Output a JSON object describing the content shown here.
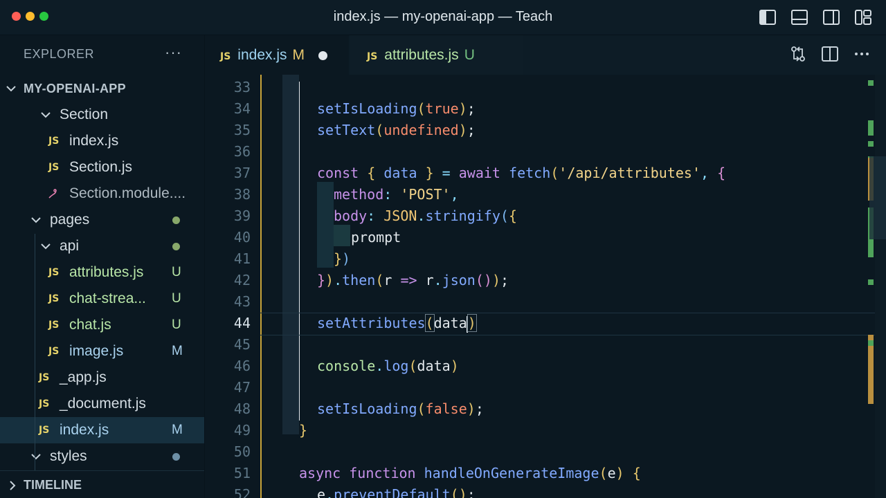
{
  "window": {
    "title": "index.js — my-openai-app — Teach"
  },
  "sidebar": {
    "header": "EXPLORER",
    "more": "···",
    "root": "MY-OPENAI-APP",
    "items": [
      {
        "label": "Section",
        "type": "folder"
      },
      {
        "label": "index.js",
        "type": "js"
      },
      {
        "label": "Section.js",
        "type": "js"
      },
      {
        "label": "Section.module....",
        "type": "css"
      },
      {
        "label": "pages",
        "type": "folder"
      },
      {
        "label": "api",
        "type": "folder"
      },
      {
        "label": "attributes.js",
        "type": "js",
        "badge": "U"
      },
      {
        "label": "chat-strea...",
        "type": "js",
        "badge": "U"
      },
      {
        "label": "chat.js",
        "type": "js",
        "badge": "U"
      },
      {
        "label": "image.js",
        "type": "js",
        "badge": "M"
      },
      {
        "label": "_app.js",
        "type": "js"
      },
      {
        "label": "_document.js",
        "type": "js"
      },
      {
        "label": "index.js",
        "type": "js",
        "badge": "M"
      },
      {
        "label": "styles",
        "type": "folder"
      }
    ],
    "js_icon": "JS",
    "timeline": "TIMELINE"
  },
  "tabs": [
    {
      "label": "index.js",
      "status": "M"
    },
    {
      "label": "attributes.js",
      "status": "U"
    }
  ],
  "editor": {
    "line_numbers": [
      "33",
      "34",
      "35",
      "36",
      "37",
      "38",
      "39",
      "40",
      "41",
      "42",
      "43",
      "44",
      "45",
      "46",
      "47",
      "48",
      "49",
      "50",
      "51",
      "52"
    ],
    "current_line": "44"
  },
  "colors": {
    "modified": "#e8c86d",
    "untracked": "#74c080",
    "js_icon": "#e6d36a",
    "selection": "#16303f"
  },
  "icons": [
    "toggle-primary-sidebar-icon",
    "toggle-panel-icon",
    "toggle-secondary-sidebar-icon",
    "customize-layout-icon",
    "open-changes-icon",
    "split-editor-icon",
    "more-actions-icon",
    "chevron-down-icon",
    "chevron-right-icon",
    "css-file-icon"
  ]
}
